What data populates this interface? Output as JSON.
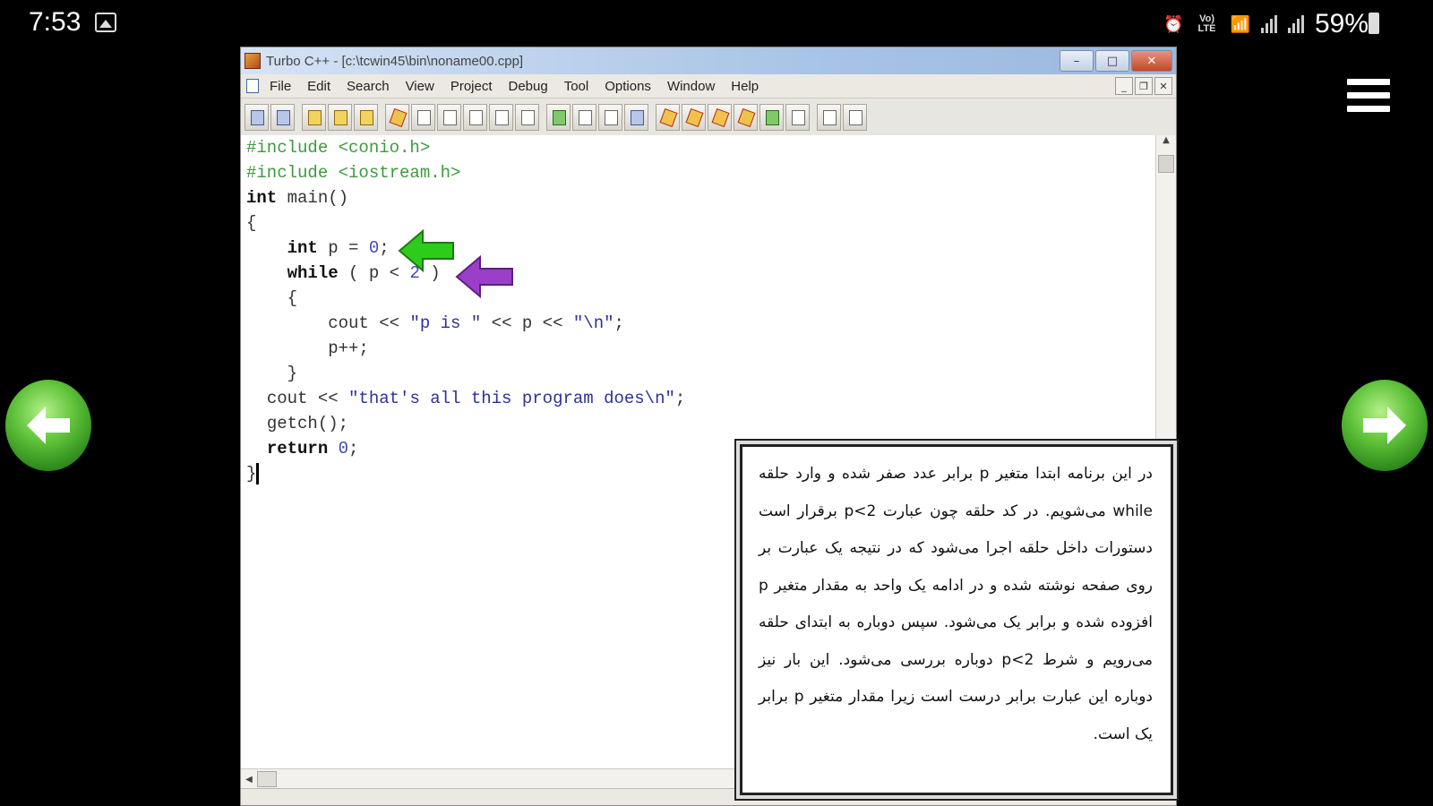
{
  "status_bar": {
    "time": "7:53",
    "volte": "Vo) LTE",
    "battery": "59%",
    "icons": [
      "gallery-icon",
      "alarm-icon",
      "wifi-icon",
      "signal-icon",
      "battery-icon"
    ]
  },
  "window": {
    "title": "Turbo C++ - [c:\\tcwin45\\bin\\noname00.cpp]",
    "menu": [
      "File",
      "Edit",
      "Search",
      "View",
      "Project",
      "Debug",
      "Tool",
      "Options",
      "Window",
      "Help"
    ]
  },
  "code": {
    "include1": "#include <conio.h>",
    "include2": "#include <iostream.h>",
    "main_kw": "int",
    "main_rest": " main()",
    "open_brace": "{",
    "decl_kw": "int",
    "decl_rest": " p = ",
    "decl_num": "0",
    "decl_end": ";",
    "while_kw": "while",
    "while_a": " ( p < ",
    "while_num": "2",
    "while_b": " )",
    "inner_open": "{",
    "cout1_a": "cout << ",
    "cout1_str": "\"p is \"",
    "cout1_b": " << p << ",
    "cout1_str2": "\"\\n\"",
    "cout1_end": ";",
    "incr": "p++;",
    "inner_close": "}",
    "cout2_a": "cout << ",
    "cout2_str": "\"that's all this program does\\n\"",
    "cout2_end": ";",
    "getch": "getch();",
    "return_kw": "return",
    "return_sp": " ",
    "return_num": "0",
    "return_end": ";",
    "close_brace": "}"
  },
  "annotations": {
    "green_arrow_color": "#2ecc1a",
    "purple_arrow_color": "#9b3fc9"
  },
  "explanation": {
    "text": "در این برنامه ابتدا متغیر p برابر عدد صفر شده و وارد حلقه while می‌شویم. در کد حلقه چون عبارت p<2 برقرار است دستورات داخل حلقه اجرا می‌شود که در نتیجه یک عبارت بر روی صفحه نوشته شده و در ادامه یک واحد به مقدار متغیر p افزوده شده و برابر یک می‌شود. سپس دوباره به ابتدای حلقه می‌رویم و شرط p<2 دوباره بررسی می‌شود. این بار نیز دوباره این عبارت برابر درست است زیرا مقدار متغیر p برابر یک است."
  }
}
